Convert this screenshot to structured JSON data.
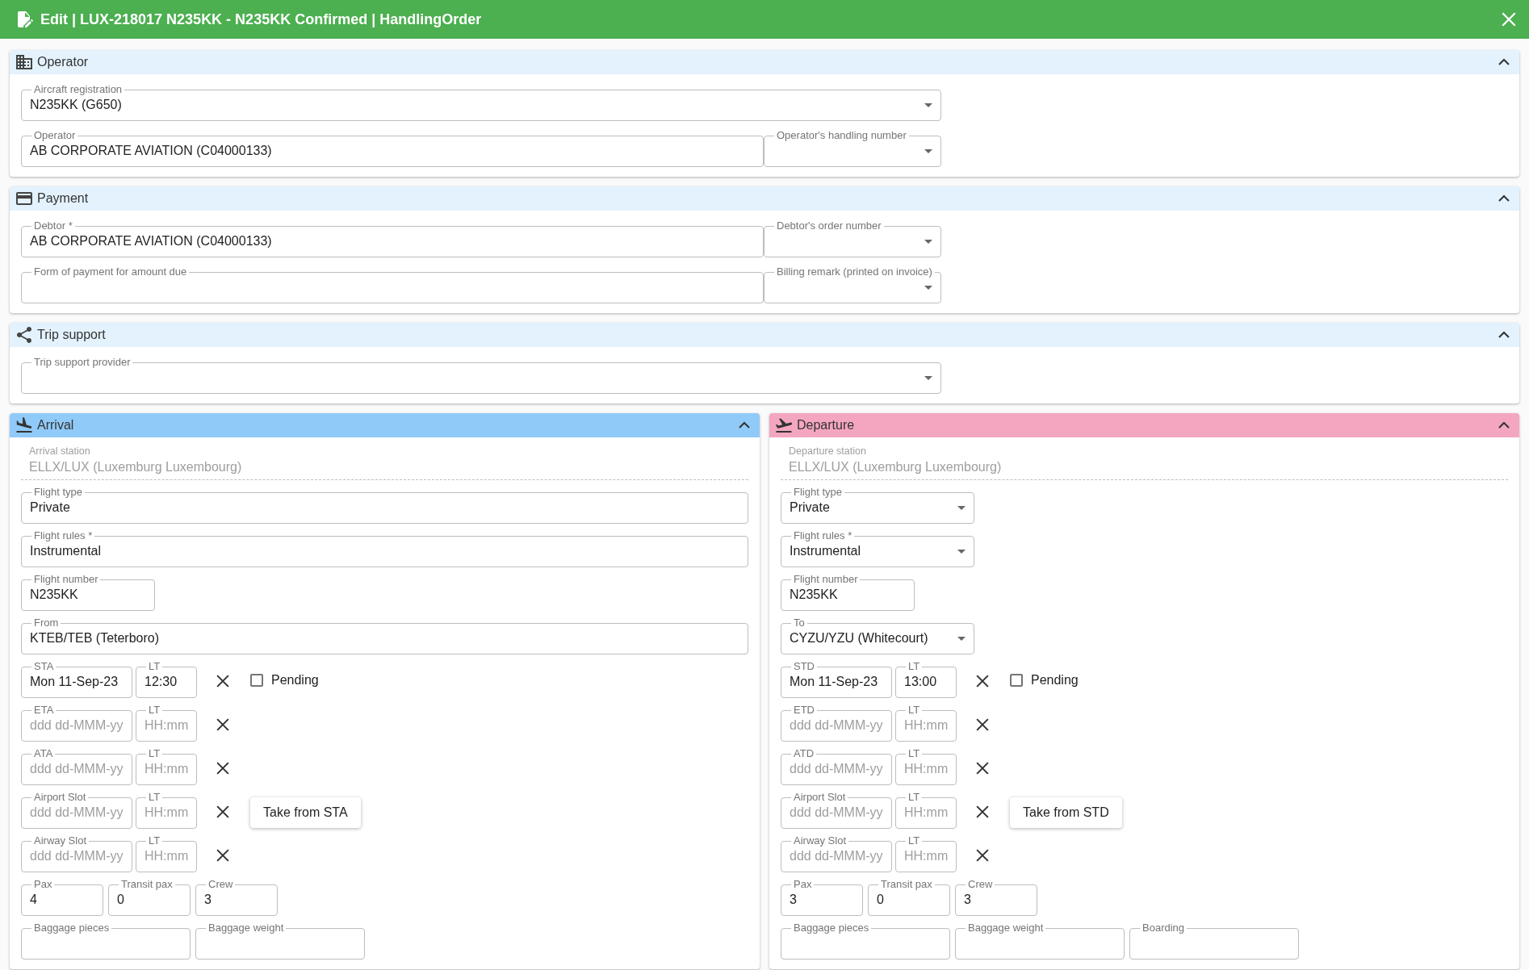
{
  "window": {
    "title": "Edit | LUX-218017 N235KK - N235KK Confirmed | HandlingOrder"
  },
  "panels": [
    {
      "title": "Operator",
      "expanded": true,
      "rows": [
        [
          {
            "kind": "combo",
            "label": "Aircraft registration",
            "value": "N235KK (G650)"
          }
        ],
        [
          {
            "kind": "text",
            "label": "Operator",
            "value": "AB CORPORATE AVIATION (C04000133)"
          },
          {
            "kind": "dropdown",
            "label": "Operator's handling number"
          }
        ]
      ]
    },
    {
      "title": "Payment",
      "expanded": true,
      "rows": [
        [
          {
            "kind": "text",
            "label": "Debtor *",
            "value": "AB CORPORATE AVIATION (C04000133)"
          },
          {
            "kind": "dropdown",
            "label": "Debtor's order number"
          }
        ],
        [
          {
            "kind": "text",
            "label": "Form of payment for amount due"
          },
          {
            "kind": "dropdown",
            "label": "Billing remark (printed on invoice)"
          }
        ]
      ]
    },
    {
      "title": "Trip support",
      "expanded": true,
      "rows": [
        [
          {
            "kind": "combo",
            "label": "Trip support provider"
          }
        ]
      ]
    }
  ],
  "legs": [
    {
      "kind": "arrival",
      "title": "Arrival",
      "expanded": true,
      "station": {
        "label": "Arrival station",
        "value": "ELLX/LUX (Luxemburg Luxembourg)"
      },
      "fields": [
        {
          "kind": "text",
          "label": "Flight type",
          "value": "Private"
        },
        {
          "kind": "text",
          "label": "Flight rules *",
          "value": "Instrumental"
        },
        {
          "kind": "short",
          "label": "Flight number",
          "value": "N235KK"
        },
        {
          "kind": "text",
          "label": "From",
          "value": "KTEB/TEB (Teterboro)"
        }
      ],
      "times": [
        {
          "date": {
            "label": "STA",
            "value": "Mon 11-Sep-23"
          },
          "time": {
            "label": "LT",
            "value": "12:30"
          },
          "pending": {
            "label": "Pending",
            "checked": false
          }
        },
        {
          "date": {
            "label": "ETA",
            "placeholder": "ddd dd-MMM-yy"
          },
          "time": {
            "label": "LT",
            "placeholder": "HH:mm"
          }
        },
        {
          "date": {
            "label": "ATA",
            "placeholder": "ddd dd-MMM-yy"
          },
          "time": {
            "label": "LT",
            "placeholder": "HH:mm"
          }
        },
        {
          "date": {
            "label": "Airport Slot",
            "placeholder": "ddd dd-MMM-yy"
          },
          "time": {
            "label": "LT",
            "placeholder": "HH:mm"
          },
          "button": "Take from STA"
        },
        {
          "date": {
            "label": "Airway Slot",
            "placeholder": "ddd dd-MMM-yy"
          },
          "time": {
            "label": "LT",
            "placeholder": "HH:mm"
          }
        }
      ],
      "counts": [
        [
          {
            "kind": "small",
            "label": "Pax",
            "value": "4"
          },
          {
            "kind": "small",
            "label": "Transit pax",
            "value": "0"
          },
          {
            "kind": "small",
            "label": "Crew",
            "value": "3"
          }
        ],
        [
          {
            "kind": "medium",
            "label": "Baggage pieces"
          },
          {
            "kind": "medium",
            "label": "Baggage weight"
          }
        ]
      ]
    },
    {
      "kind": "departure",
      "title": "Departure",
      "expanded": true,
      "station": {
        "label": "Departure station",
        "value": "ELLX/LUX (Luxemburg Luxembourg)"
      },
      "fields": [
        {
          "kind": "dropdown",
          "label": "Flight type",
          "value": "Private"
        },
        {
          "kind": "dropdown",
          "label": "Flight rules *",
          "value": "Instrumental"
        },
        {
          "kind": "short",
          "label": "Flight number",
          "value": "N235KK"
        },
        {
          "kind": "dropdown",
          "label": "To",
          "value": "CYZU/YZU (Whitecourt)"
        }
      ],
      "times": [
        {
          "date": {
            "label": "STD",
            "value": "Mon 11-Sep-23"
          },
          "time": {
            "label": "LT",
            "value": "13:00"
          },
          "pending": {
            "label": "Pending",
            "checked": false
          }
        },
        {
          "date": {
            "label": "ETD",
            "placeholder": "ddd dd-MMM-yy"
          },
          "time": {
            "label": "LT",
            "placeholder": "HH:mm"
          }
        },
        {
          "date": {
            "label": "ATD",
            "placeholder": "ddd dd-MMM-yy"
          },
          "time": {
            "label": "LT",
            "placeholder": "HH:mm"
          }
        },
        {
          "date": {
            "label": "Airport Slot",
            "placeholder": "ddd dd-MMM-yy"
          },
          "time": {
            "label": "LT",
            "placeholder": "HH:mm"
          },
          "button": "Take from STD"
        },
        {
          "date": {
            "label": "Airway Slot",
            "placeholder": "ddd dd-MMM-yy"
          },
          "time": {
            "label": "LT",
            "placeholder": "HH:mm"
          }
        }
      ],
      "counts": [
        [
          {
            "kind": "small",
            "label": "Pax",
            "value": "3"
          },
          {
            "kind": "small",
            "label": "Transit pax",
            "value": "0"
          },
          {
            "kind": "small",
            "label": "Crew",
            "value": "3"
          }
        ],
        [
          {
            "kind": "medium",
            "label": "Baggage pieces"
          },
          {
            "kind": "medium",
            "label": "Baggage weight"
          },
          {
            "kind": "medium",
            "label": "Boarding"
          }
        ]
      ]
    }
  ]
}
